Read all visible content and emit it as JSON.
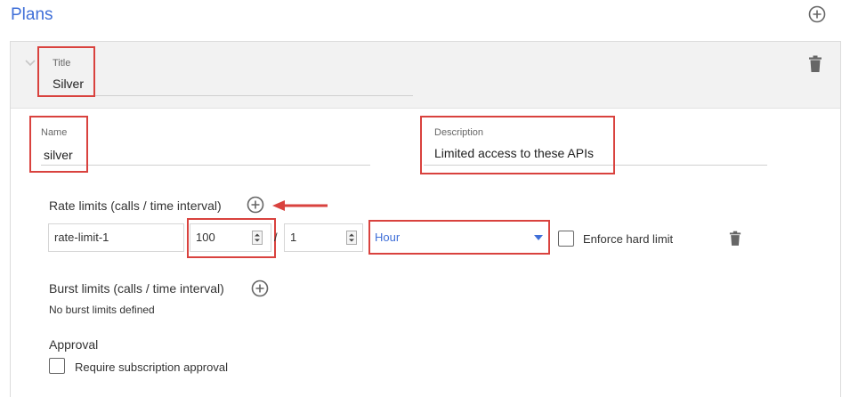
{
  "header": {
    "title": "Plans",
    "add_icon": "plus-circle-icon"
  },
  "plan": {
    "title_label": "Title",
    "title_value": "Silver",
    "name_label": "Name",
    "name_value": "silver",
    "description_label": "Description",
    "description_value": "Limited access to these APIs",
    "delete_icon": "trash-icon"
  },
  "rate_limits": {
    "heading": "Rate limits (calls / time interval)",
    "name": "rate-limit-1",
    "calls": "100",
    "separator": "/",
    "interval_count": "1",
    "interval_unit": "Hour",
    "enforce_label": "Enforce hard limit",
    "enforce_checked": false
  },
  "burst_limits": {
    "heading": "Burst limits (calls / time interval)",
    "empty_text": "No burst limits defined"
  },
  "approval": {
    "heading": "Approval",
    "require_label": "Require subscription approval",
    "require_checked": false
  },
  "colors": {
    "accent": "#3f6fd8",
    "highlight": "#d9423e"
  }
}
